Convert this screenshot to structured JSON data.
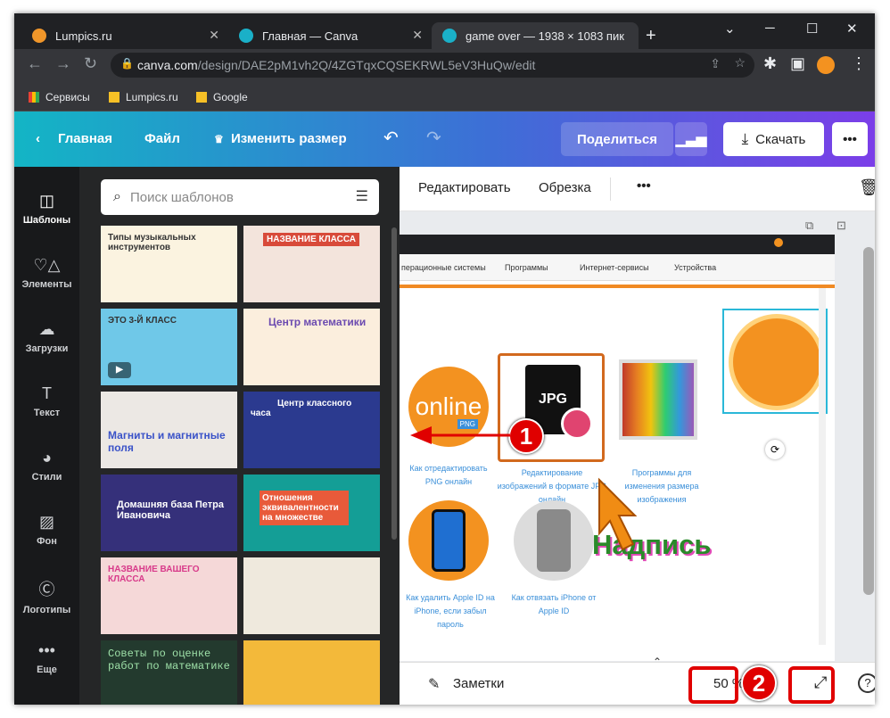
{
  "tabs": [
    {
      "title": "Lumpics.ru",
      "fav": "#f0962a"
    },
    {
      "title": "Главная — Canva",
      "fav": "#1ab0c8"
    },
    {
      "title": "game over — 1938 × 1083 пик",
      "fav": "#1ab0c8"
    }
  ],
  "address": {
    "domain": "canva.com",
    "path": "/design/DAE2pM1vh2Q/4ZGTqxCQSEKRWL5eV3HuQw/edit"
  },
  "bookmarks": [
    "Сервисы",
    "Lumpics.ru",
    "Google"
  ],
  "canva_bar": {
    "home": "Главная",
    "file": "Файл",
    "resize": "Изменить размер",
    "share": "Поделиться",
    "download": "Скачать"
  },
  "rail": [
    "Шаблоны",
    "Элементы",
    "Загрузки",
    "Текст",
    "Стили",
    "Фон",
    "Логотипы",
    "Еще"
  ],
  "search": {
    "placeholder": "Поиск шаблонов"
  },
  "templates": [
    {
      "title": "Типы музыкальных инструментов",
      "bg": "#fbf3e0"
    },
    {
      "title": "НАЗВАНИЕ КЛАССА",
      "bg": "#f3e4dc"
    },
    {
      "title": "ЭТО 3-Й КЛАСС",
      "bg": "#6fc8e8"
    },
    {
      "title": "Центр математики",
      "bg": "#fbeedd"
    },
    {
      "title": "Магниты и магнитные поля",
      "bg": "#ece8e4"
    },
    {
      "title": "Центр классного часа",
      "bg": "#2b3a8f"
    },
    {
      "title": "Домашняя база Петра Ивановича",
      "bg": "#35307a"
    },
    {
      "title": "Отношения эквивалентности на множестве",
      "bg": "#149e96"
    },
    {
      "title": "НАЗВАНИЕ ВАШЕГО КЛАССА",
      "bg": "#f5d8d8"
    },
    {
      "title": "",
      "bg": "#efe9dd"
    },
    {
      "title": "Советы по оценке работ по математике",
      "bg": "#233a2e"
    },
    {
      "title": "",
      "bg": "#f3b93a"
    }
  ],
  "edit_toolbar": {
    "edit": "Редактировать",
    "crop": "Обрезка"
  },
  "canvas": {
    "nav": [
      "перационные системы",
      "Программы",
      "Интернет-сервисы",
      "Устройства"
    ],
    "captions": [
      "Как отредактировать PNG онлайн",
      "Редактирование изображений в формате JPG онлайн",
      "Программы для изменения размера изображения",
      "Как удалить Apple ID на iPhone, если забыл пароль",
      "Как отвязать iPhone от Apple ID"
    ],
    "online_text": "online",
    "png_text": "PNG",
    "jpg_text": "JPG",
    "nadpis": "Надпись"
  },
  "badges": [
    "1",
    "2"
  ],
  "bottom": {
    "notes": "Заметки",
    "zoom": "50 %",
    "help": "?"
  }
}
